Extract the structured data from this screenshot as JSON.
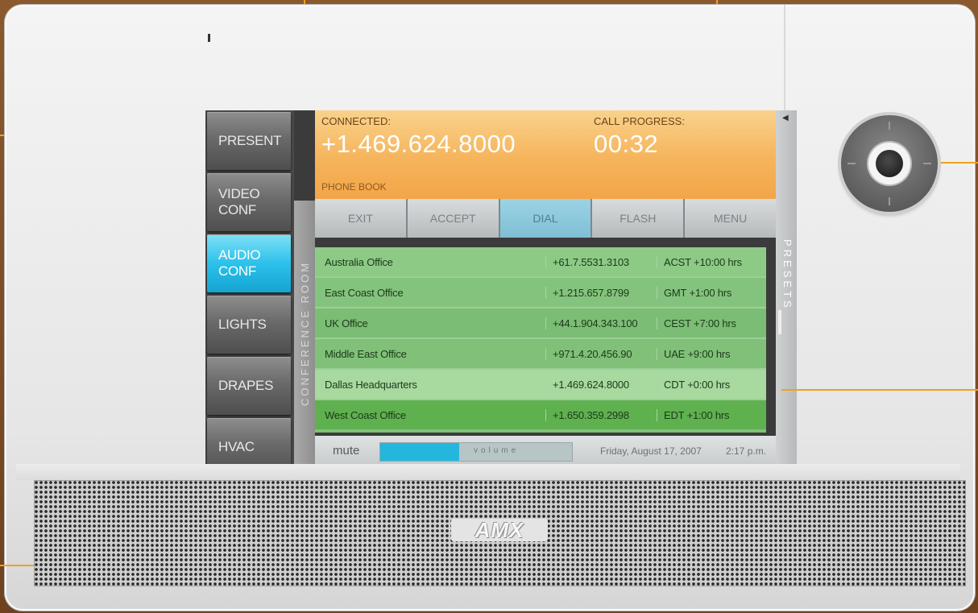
{
  "sidebar": {
    "items": [
      {
        "label": "PRESENT"
      },
      {
        "label": "VIDEO\nCONF"
      },
      {
        "label": "AUDIO\nCONF",
        "active": true
      },
      {
        "label": "LIGHTS"
      },
      {
        "label": "DRAPES"
      },
      {
        "label": "HVAC"
      }
    ]
  },
  "room_label": "CONFERENCE ROOM",
  "status": {
    "connected_label": "CONNECTED:",
    "connected_number": "+1.469.624.8000",
    "progress_label": "CALL PROGRESS:",
    "progress_time": "00:32",
    "phonebook_label": "PHONE BOOK"
  },
  "softkeys": [
    {
      "label": "EXIT"
    },
    {
      "label": "ACCEPT"
    },
    {
      "label": "DIAL",
      "active": true
    },
    {
      "label": "FLASH"
    },
    {
      "label": "MENU"
    }
  ],
  "presets_label": "PRESETS",
  "phonebook": [
    {
      "name": "Australia Office",
      "number": "+61.7.5531.3103",
      "zone": "ACST +10:00 hrs"
    },
    {
      "name": "East Coast Office",
      "number": "+1.215.657.8799",
      "zone": "GMT  +1:00 hrs"
    },
    {
      "name": "UK Office",
      "number": "+44.1.904.343.100",
      "zone": "CEST  +7:00 hrs"
    },
    {
      "name": "Middle East Office",
      "number": "+971.4.20.456.90",
      "zone": "UAE  +9:00 hrs"
    },
    {
      "name": "Dallas Headquarters",
      "number": "+1.469.624.8000",
      "zone": "CDT  +0:00 hrs"
    },
    {
      "name": "West Coast Office",
      "number": "+1.650.359.2998",
      "zone": "EDT  +1:00 hrs"
    }
  ],
  "footer": {
    "mute_label": "mute",
    "volume_label": "volume",
    "volume_level": 0.41,
    "date": "Friday, August 17, 2007",
    "time": "2:17 p.m."
  },
  "brand": "AMX",
  "colors": {
    "accent": "#f0a21a",
    "active_button": "#2cc1ea",
    "status_bar": "#f6b45b",
    "list_green": "#7fc07a"
  }
}
